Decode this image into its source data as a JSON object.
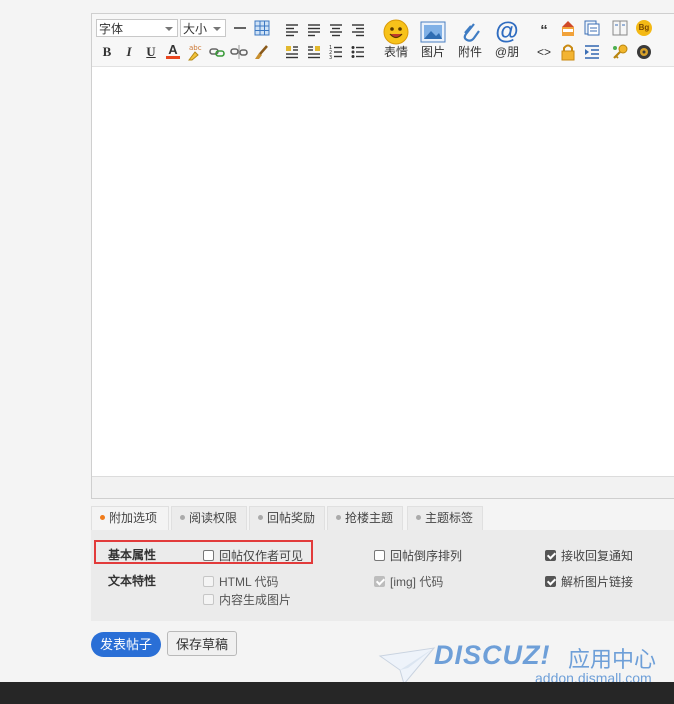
{
  "toolbar": {
    "font_select": "字体",
    "size_select": "大小",
    "emoji_label": "表情",
    "image_label": "图片",
    "attach_label": "附件",
    "at_label": "@朋",
    "bold": "B",
    "italic": "I",
    "underline": "U",
    "text_color": "A",
    "quote": "“",
    "code": "<>",
    "bg": "Bg"
  },
  "tabs": [
    {
      "label": "附加选项",
      "active": true
    },
    {
      "label": "阅读权限",
      "active": false
    },
    {
      "label": "回帖奖励",
      "active": false
    },
    {
      "label": "抢楼主题",
      "active": false
    },
    {
      "label": "主题标签",
      "active": false
    }
  ],
  "options": {
    "basic_label": "基本属性",
    "text_label": "文本特性",
    "reply_author_only": "回帖仅作者可见",
    "reply_reverse": "回帖倒序排列",
    "receive_notify": "接收回复通知",
    "html_code": "HTML 代码",
    "img_code": "[img] 代码",
    "parse_links": "解析图片链接",
    "content_to_image": "内容生成图片"
  },
  "buttons": {
    "publish": "发表帖子",
    "save_draft": "保存草稿"
  },
  "watermark": {
    "logo": "DISCUZ!",
    "title": "应用中心",
    "url": "addon.dismall.com"
  },
  "colors": {
    "accent": "#2a6fd6",
    "highlight": "#e23b3b",
    "active_dot": "#f07b1a"
  }
}
